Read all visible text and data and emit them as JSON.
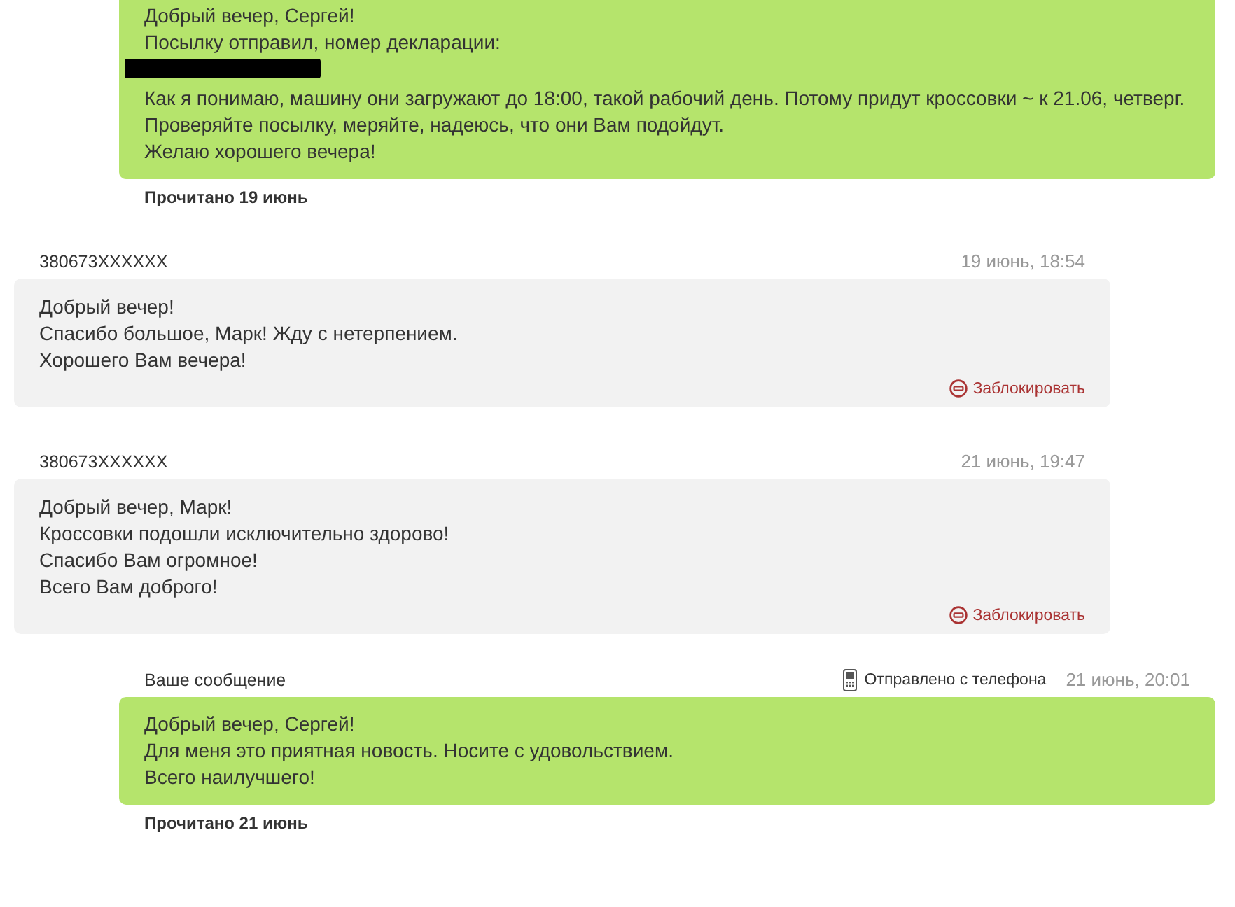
{
  "messages": [
    {
      "kind": "outgoing",
      "lines": [
        {
          "kind": "text",
          "text": "Добрый вечер, Сергей!"
        },
        {
          "kind": "text",
          "text": "Посылку отправил, номер декларации:"
        },
        {
          "kind": "redacted"
        },
        {
          "kind": "text",
          "text": "Как я понимаю, машину они загружают до 18:00, такой рабочий день. Потому придут кроссовки ~ к 21.06, четверг."
        },
        {
          "kind": "text",
          "text": "Проверяйте посылку, меряйте, надеюсь, что они Вам подойдут."
        },
        {
          "kind": "text",
          "text": "Желаю хорошего вечера!"
        }
      ],
      "read_status": "Прочитано 19 июнь"
    },
    {
      "kind": "incoming",
      "sender": "380673XXXXXX",
      "time": "19 июнь, 18:54",
      "lines": [
        {
          "kind": "text",
          "text": "Добрый вечер!"
        },
        {
          "kind": "text",
          "text": "Спасибо большое, Марк! Жду с нетерпением."
        },
        {
          "kind": "text",
          "text": "Хорошего Вам вечера!"
        }
      ],
      "block_label": "Заблокировать"
    },
    {
      "kind": "incoming",
      "sender": "380673XXXXXX",
      "time": "21 июнь, 19:47",
      "lines": [
        {
          "kind": "text",
          "text": "Добрый вечер, Марк!"
        },
        {
          "kind": "text",
          "text": "Кроссовки подошли исключительно здорово!"
        },
        {
          "kind": "text",
          "text": "Спасибо Вам огромное!"
        },
        {
          "kind": "text",
          "text": "Всего Вам доброго!"
        }
      ],
      "block_label": "Заблокировать"
    },
    {
      "kind": "outgoing",
      "header": "Ваше сообщение",
      "via": "Отправлено с телефона",
      "time": "21 июнь, 20:01",
      "lines": [
        {
          "kind": "text",
          "text": "Добрый вечер, Сергей!"
        },
        {
          "kind": "text",
          "text": "Для меня это приятная новость. Носите с удовольствием."
        },
        {
          "kind": "text",
          "text": "Всего наилучшего!"
        }
      ],
      "read_status": "Прочитано 21 июнь"
    }
  ]
}
